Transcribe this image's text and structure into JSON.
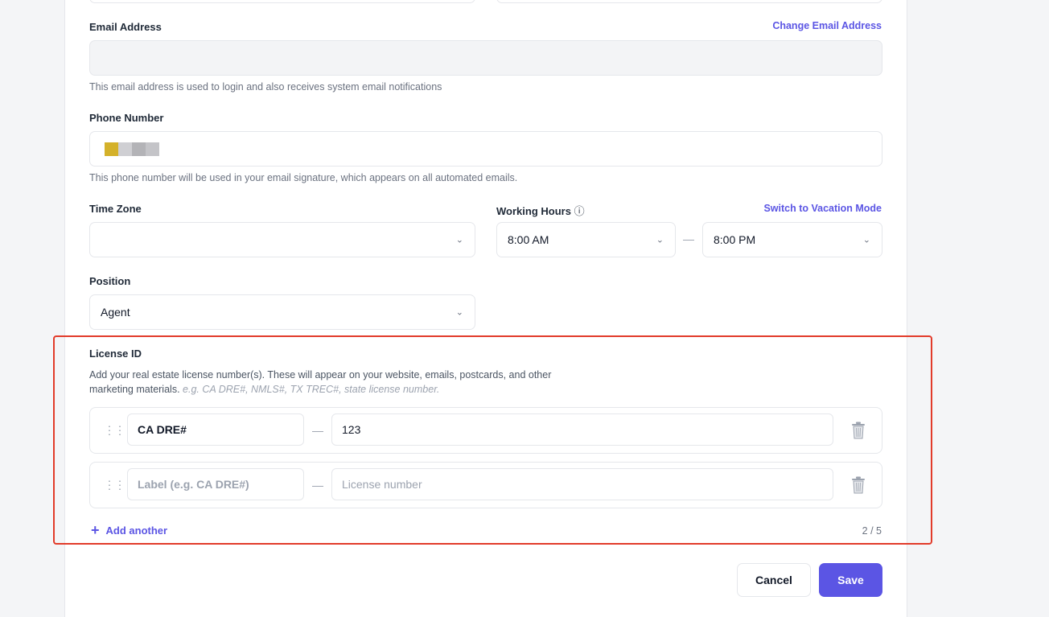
{
  "email": {
    "label": "Email Address",
    "change_link": "Change Email Address",
    "value": "",
    "help": "This email address is used to login and also receives system email notifications"
  },
  "phone": {
    "label": "Phone Number",
    "value": "",
    "help": "This phone number will be used in your email signature, which appears on all automated emails."
  },
  "timezone": {
    "label": "Time Zone",
    "value": ""
  },
  "working_hours": {
    "label": "Working Hours",
    "info_icon": "ⓘ",
    "vacation_link": "Switch to Vacation Mode",
    "start": "8:00 AM",
    "separator": "—",
    "end": "8:00 PM"
  },
  "position": {
    "label": "Position",
    "value": "Agent"
  },
  "license": {
    "title": "License ID",
    "description": "Add your real estate license number(s). These will appear on your website, emails, postcards, and other marketing materials.",
    "example": "e.g. CA DRE#, NMLS#, TX TREC#, state license number.",
    "rows": [
      {
        "label": "CA DRE#",
        "label_placeholder": "Label (e.g. CA DRE#)",
        "number": "123",
        "number_placeholder": "License number"
      },
      {
        "label": "",
        "label_placeholder": "Label (e.g. CA DRE#)",
        "number": "",
        "number_placeholder": "License number"
      }
    ],
    "add_another": "Add another",
    "count": "2 / 5"
  },
  "actions": {
    "cancel": "Cancel",
    "save": "Save"
  },
  "colors": {
    "accent": "#5b55e4",
    "highlight": "#e23b2a"
  }
}
